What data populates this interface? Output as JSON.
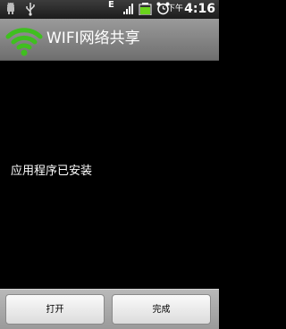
{
  "status_bar": {
    "icons": [
      "android-debug-icon",
      "usb-icon",
      "edge-icon",
      "signal-icon",
      "battery-icon",
      "alarm-icon"
    ],
    "network_label": "E",
    "ampm": "下午",
    "time": "4:16"
  },
  "title_bar": {
    "title": "WIFI网络共享",
    "icon": "wifi-icon",
    "accent_color": "#3fbf1f"
  },
  "main": {
    "message": "应用程序已安装"
  },
  "buttons": {
    "open_label": "打开",
    "done_label": "完成"
  }
}
